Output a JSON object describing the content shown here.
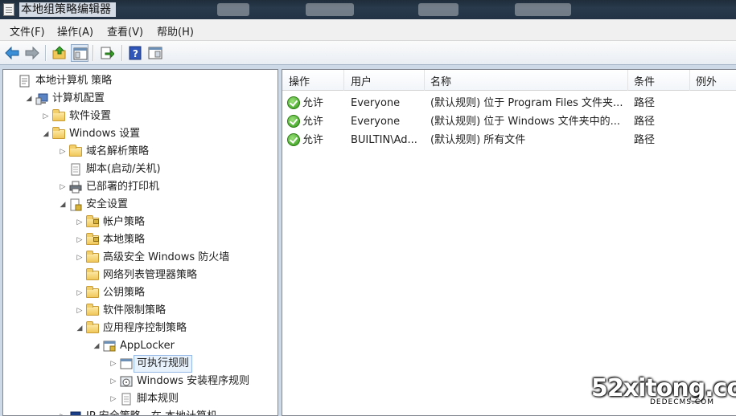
{
  "window": {
    "title": "本地组策略编辑器"
  },
  "menu": [
    "文件(F)",
    "操作(A)",
    "查看(V)",
    "帮助(H)"
  ],
  "toolbar": {
    "buttons": [
      {
        "name": "back-arrow-icon"
      },
      {
        "name": "forward-arrow-icon"
      },
      {
        "name": "up-folder-icon"
      },
      {
        "name": "show-hide-tree-icon"
      },
      {
        "name": "export-list-icon"
      },
      {
        "name": "help-icon"
      },
      {
        "name": "properties-icon"
      }
    ]
  },
  "tree": [
    {
      "label": "本地计算机 策略",
      "depth": 0,
      "arrow": "",
      "icon": "policy-doc"
    },
    {
      "label": "计算机配置",
      "depth": 1,
      "arrow": "◢",
      "icon": "computer"
    },
    {
      "label": "软件设置",
      "depth": 2,
      "arrow": "▷",
      "icon": "folder"
    },
    {
      "label": "Windows 设置",
      "depth": 2,
      "arrow": "◢",
      "icon": "folder"
    },
    {
      "label": "域名解析策略",
      "depth": 3,
      "arrow": "▷",
      "icon": "folder"
    },
    {
      "label": "脚本(启动/关机)",
      "depth": 3,
      "arrow": "",
      "icon": "script"
    },
    {
      "label": "已部署的打印机",
      "depth": 3,
      "arrow": "▷",
      "icon": "printer"
    },
    {
      "label": "安全设置",
      "depth": 3,
      "arrow": "◢",
      "icon": "security"
    },
    {
      "label": "帐户策略",
      "depth": 4,
      "arrow": "▷",
      "icon": "folder-lock"
    },
    {
      "label": "本地策略",
      "depth": 4,
      "arrow": "▷",
      "icon": "folder-lock"
    },
    {
      "label": "高级安全 Windows 防火墙",
      "depth": 4,
      "arrow": "▷",
      "icon": "folder"
    },
    {
      "label": "网络列表管理器策略",
      "depth": 4,
      "arrow": "",
      "icon": "folder"
    },
    {
      "label": "公钥策略",
      "depth": 4,
      "arrow": "▷",
      "icon": "folder"
    },
    {
      "label": "软件限制策略",
      "depth": 4,
      "arrow": "▷",
      "icon": "folder"
    },
    {
      "label": "应用程序控制策略",
      "depth": 4,
      "arrow": "◢",
      "icon": "folder"
    },
    {
      "label": "AppLocker",
      "depth": 5,
      "arrow": "◢",
      "icon": "applocker"
    },
    {
      "label": "可执行规则",
      "depth": 6,
      "arrow": "▷",
      "icon": "rule",
      "selected": true
    },
    {
      "label": "Windows 安装程序规则",
      "depth": 6,
      "arrow": "▷",
      "icon": "installer"
    },
    {
      "label": "脚本规则",
      "depth": 6,
      "arrow": "▷",
      "icon": "script-rule"
    },
    {
      "label": "IP 安全策略，在 本地计算机",
      "depth": 3,
      "arrow": "▷",
      "icon": "ipsec"
    }
  ],
  "list": {
    "columns": [
      "操作",
      "用户",
      "名称",
      "条件",
      "例外"
    ],
    "rows": [
      {
        "action": "允许",
        "user": "Everyone",
        "name": "(默认规则) 位于 Program Files 文件夹...",
        "condition": "路径",
        "exception": ""
      },
      {
        "action": "允许",
        "user": "Everyone",
        "name": "(默认规则) 位于 Windows 文件夹中的...",
        "condition": "路径",
        "exception": ""
      },
      {
        "action": "允许",
        "user": "BUILTIN\\Ad...",
        "name": "(默认规则) 所有文件",
        "condition": "路径",
        "exception": ""
      }
    ]
  },
  "watermark": {
    "main": "52xitong.com",
    "sub": "DEDECMS.COM"
  }
}
